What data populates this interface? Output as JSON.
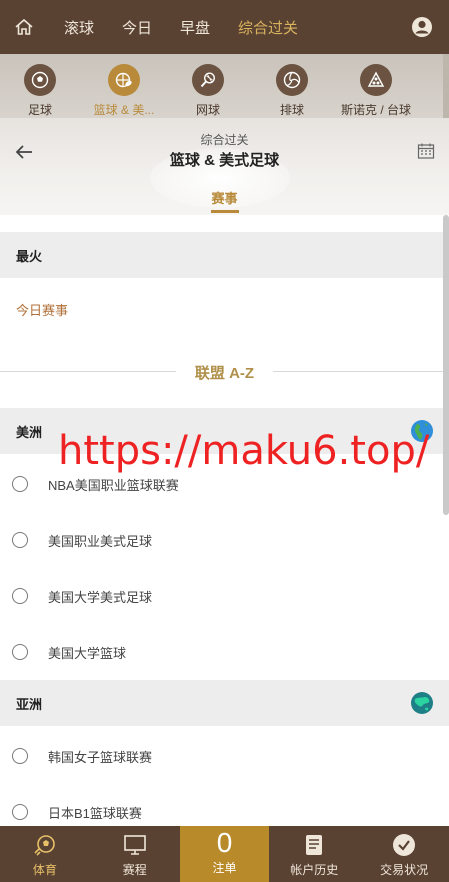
{
  "nav": {
    "items": [
      "滚球",
      "今日",
      "早盘",
      "综合过关"
    ],
    "active_index": 3
  },
  "sports": [
    {
      "label": "足球",
      "icon": "soccer-ball-icon"
    },
    {
      "label": "篮球 & 美...",
      "icon": "basketball-football-icon",
      "active": true
    },
    {
      "label": "网球",
      "icon": "tennis-icon"
    },
    {
      "label": "排球",
      "icon": "volleyball-icon"
    },
    {
      "label": "斯诺克 / 台球",
      "icon": "snooker-icon"
    }
  ],
  "header": {
    "subtitle": "综合过关",
    "title": "篮球 & 美式足球",
    "tab": "赛事"
  },
  "hot": {
    "heading": "最火",
    "today_link": "今日赛事"
  },
  "az_heading": "联盟 A-Z",
  "regions": [
    {
      "name": "美洲",
      "leagues": [
        "NBA美国职业篮球联赛",
        "美国职业美式足球",
        "美国大学美式足球",
        "美国大学篮球"
      ]
    },
    {
      "name": "亚洲",
      "leagues": [
        "韩国女子篮球联赛",
        "日本B1篮球联赛"
      ]
    }
  ],
  "watermark": "https://maku6.top/",
  "bottom": {
    "sports": "体育",
    "schedule": "赛程",
    "slip_count": "0",
    "slip": "注单",
    "history": "帐户历史",
    "status": "交易状况"
  },
  "colors": {
    "brown": "#5a4232",
    "gold": "#b88a3a",
    "link": "#b0703a"
  }
}
